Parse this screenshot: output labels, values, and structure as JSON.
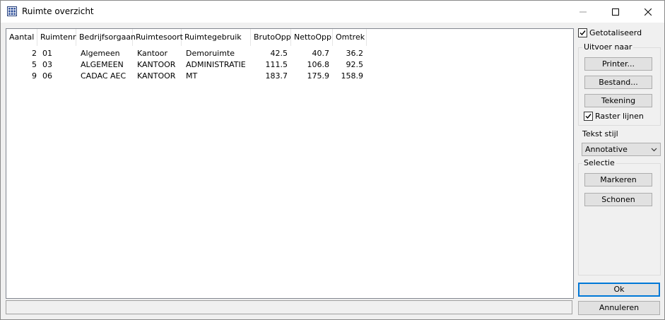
{
  "window": {
    "title": "Ruimte overzicht",
    "icon": "grid-app-icon"
  },
  "list": {
    "columns": [
      "Aantal",
      "Ruimtenr",
      "Bedrijfsorgaan",
      "Ruimtesoort",
      "Ruimtegebruik",
      "BrutoOpp",
      "NettoOpp",
      "Omtrek"
    ],
    "rows": [
      [
        "2",
        "01",
        "Algemeen",
        "Kantoor",
        "Demoruimte",
        "42.5",
        "40.7",
        "36.2"
      ],
      [
        "5",
        "03",
        "ALGEMEEN",
        "KANTOOR",
        "ADMINISTRATIE",
        "111.5",
        "106.8",
        "92.5"
      ],
      [
        "9",
        "06",
        "CADAC AEC",
        "KANTOOR",
        "MT",
        "183.7",
        "175.9",
        "158.9"
      ]
    ]
  },
  "sidebar": {
    "totalized": {
      "label": "Getotaliseerd",
      "checked": true
    },
    "output": {
      "title": "Uitvoer naar",
      "printer_label": "Printer...",
      "file_label": "Bestand...",
      "drawing_label": "Tekening",
      "grid_lines": {
        "label": "Raster lijnen",
        "checked": true
      }
    },
    "text_style": {
      "label": "Tekst stijl",
      "value": "Annotative"
    },
    "selection": {
      "title": "Selectie",
      "mark_label": "Markeren",
      "clear_label": "Schonen"
    },
    "ok_label": "Ok",
    "cancel_label": "Annuleren"
  }
}
